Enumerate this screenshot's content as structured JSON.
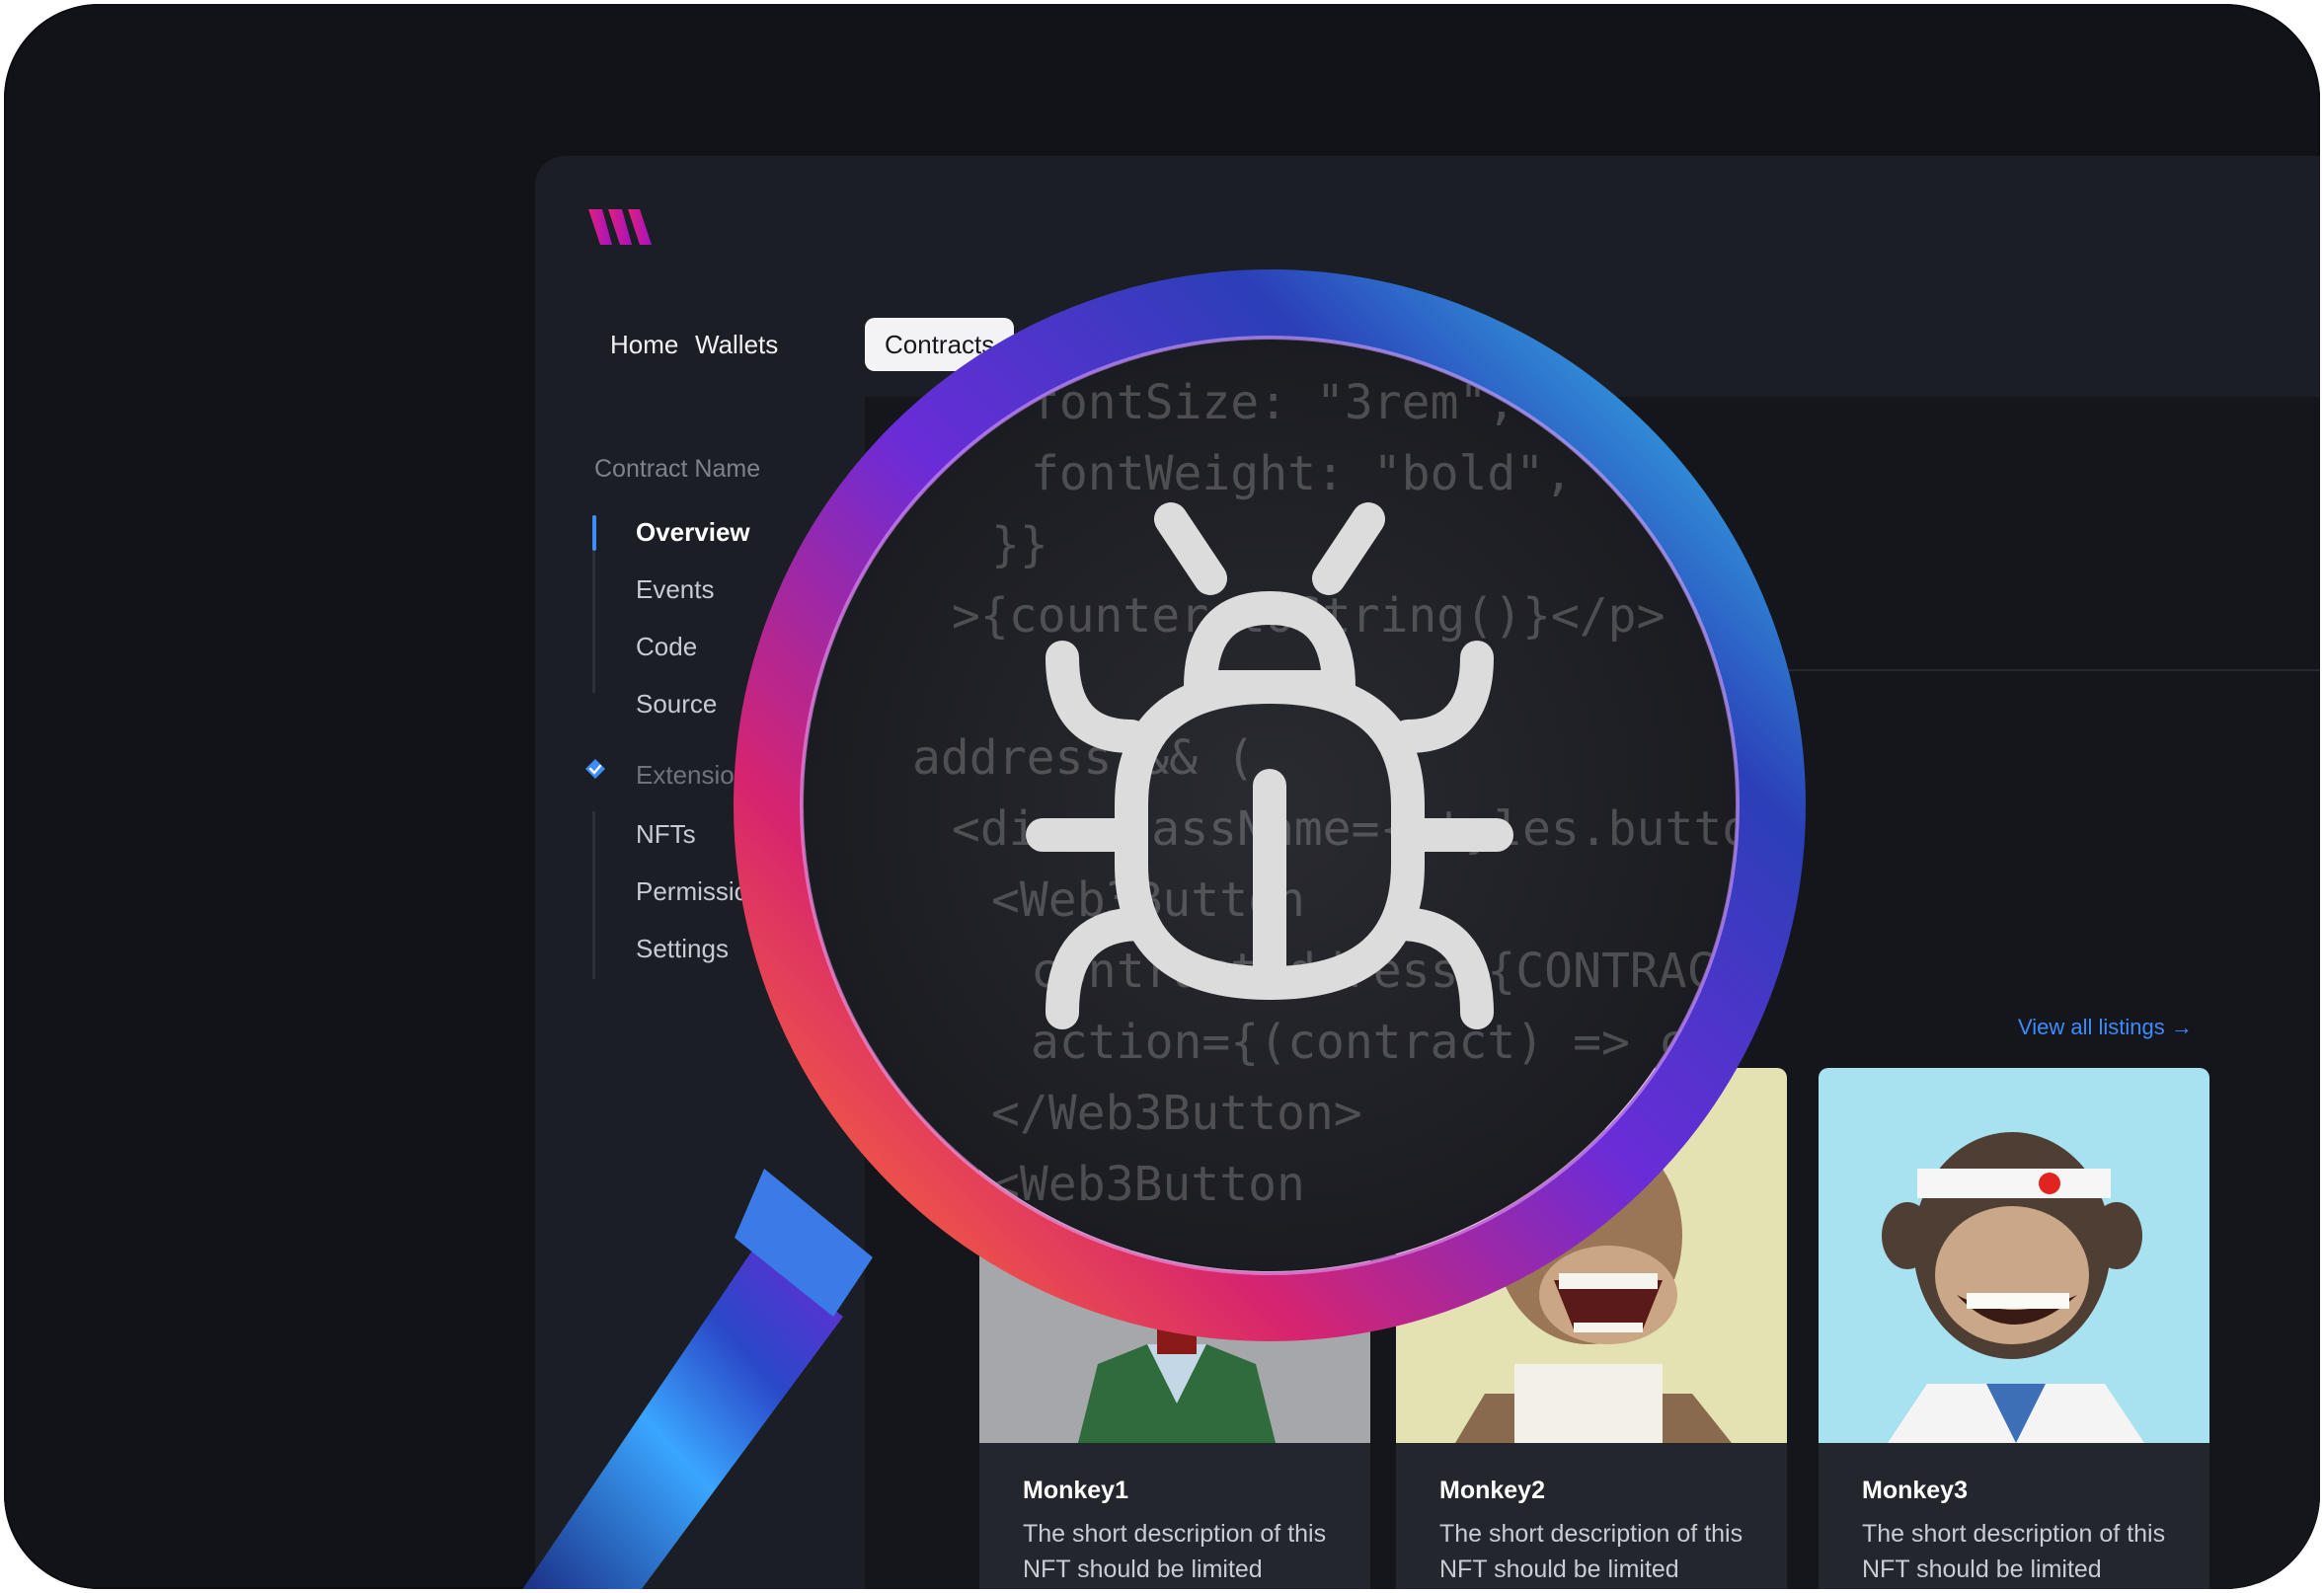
{
  "nav": {
    "home": "Home",
    "wallets": "Wallets",
    "contracts": "Contracts"
  },
  "sidebar": {
    "title": "Contract Name",
    "items": [
      "Overview",
      "Events",
      "Code",
      "Source"
    ],
    "extensions_label": "Extensio",
    "ext_items": [
      "NFTs",
      "Permissio",
      "Settings"
    ]
  },
  "listings": {
    "view_all": "View all listings →",
    "cards": [
      {
        "title": "Monkey1",
        "desc": "The short description of this NFT should be limited",
        "bg": "#a5a7ab"
      },
      {
        "title": "Monkey2",
        "desc": "The short description of this NFT should be limited",
        "bg": "#e4e2b2"
      },
      {
        "title": "Monkey3",
        "desc": "The short description of this NFT should be limited",
        "bg": "#a8e1ef"
      }
    ]
  },
  "code_lines": [
    "fontSize: \"3rem\",",
    "fontWeight: \"bold\",",
    "}}",
    ">{counter.toString()}</p>",
    "",
    "address && (",
    "<div className={styles.buttonC",
    "<Web3Button",
    "contractAddress={CONTRACT",
    "action={(contract) => co",
    "</Web3Button>",
    "<Web3Button"
  ],
  "icons": {
    "logo": "brand-logo",
    "bug": "bug-icon",
    "check": "check-badge-icon",
    "magnifier": "magnifying-glass-icon"
  },
  "colors": {
    "accent": "#3f8cff",
    "brand": "#c0169d"
  }
}
